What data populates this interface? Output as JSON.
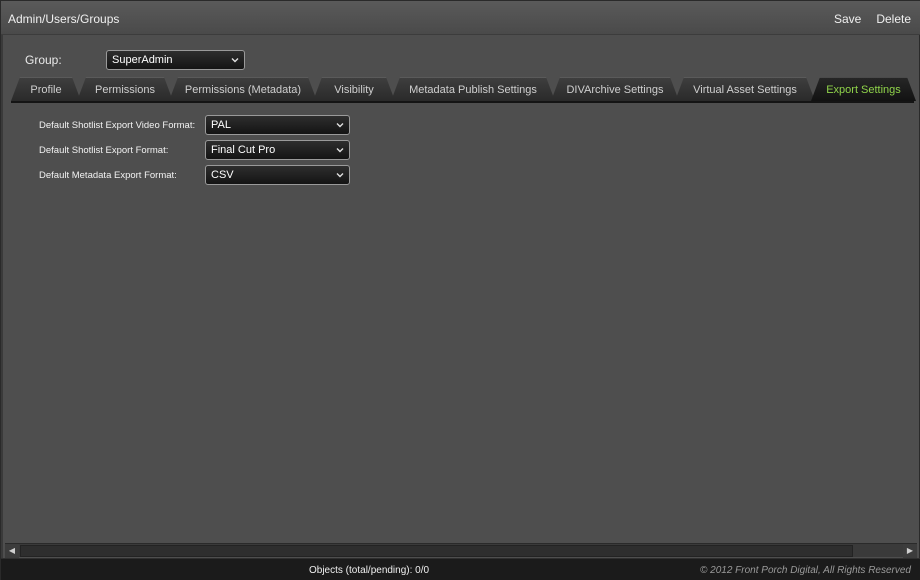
{
  "header": {
    "breadcrumb": "Admin/Users/Groups",
    "save_label": "Save",
    "delete_label": "Delete"
  },
  "group": {
    "label": "Group:",
    "selected": "SuperAdmin"
  },
  "tabs": [
    {
      "label": "Profile"
    },
    {
      "label": "Permissions"
    },
    {
      "label": "Permissions (Metadata)"
    },
    {
      "label": "Visibility"
    },
    {
      "label": "Metadata Publish Settings"
    },
    {
      "label": "DIVArchive Settings"
    },
    {
      "label": "Virtual Asset Settings"
    },
    {
      "label": "Export Settings",
      "active": true
    }
  ],
  "export_settings": {
    "video_format": {
      "label": "Default Shotlist Export Video Format:",
      "value": "PAL"
    },
    "shotlist_format": {
      "label": "Default Shotlist Export Format:",
      "value": "Final Cut Pro"
    },
    "metadata_format": {
      "label": "Default Metadata Export Format:",
      "value": "CSV"
    }
  },
  "status": {
    "objects_text": "Objects (total/pending): 0/0",
    "copyright": "© 2012 Front Porch Digital, All Rights Reserved"
  },
  "colors": {
    "active_tab_text": "#8fd34a",
    "panel_bg": "#4e4e4e",
    "status_bg": "#1b1b1b"
  }
}
